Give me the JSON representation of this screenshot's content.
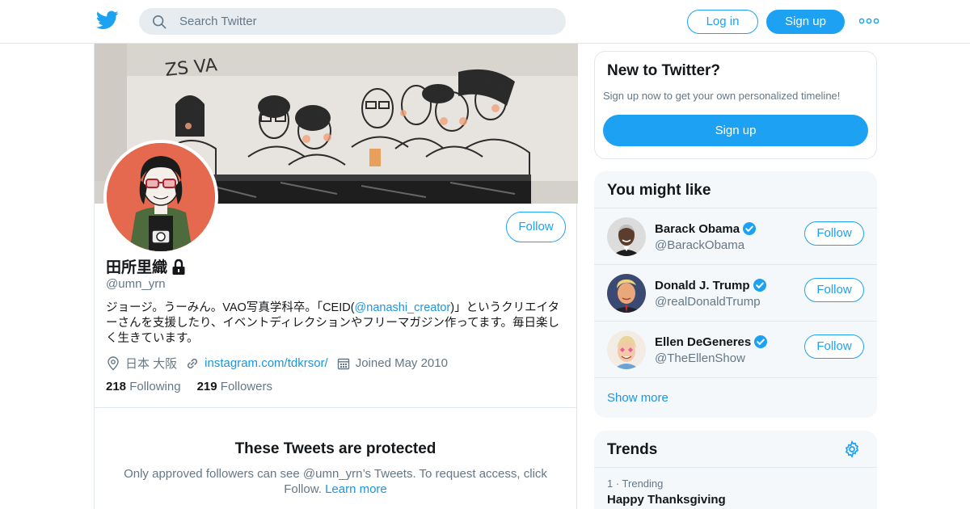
{
  "nav": {
    "search_placeholder": "Search Twitter",
    "login_label": "Log in",
    "signup_label": "Sign up"
  },
  "profile": {
    "display_name": "田所里織",
    "handle": "@umn_yrn",
    "bio_part1": "ジョージ。うーみん。VAO写真学科卒。「CEID(",
    "bio_mention": "@nanashi_creator",
    "bio_part2": ")」というクリエイターさんを支援したり、イベントディレクションやフリーマガジン作ってます。毎日楽しく生きています。",
    "location": "日本 大阪",
    "website": "instagram.com/tdkrsor/",
    "joined": "Joined May 2010",
    "following_count": "218",
    "following_label": "Following",
    "followers_count": "219",
    "followers_label": "Followers",
    "follow_label": "Follow",
    "protected_title": "These Tweets are protected",
    "protected_desc": "Only approved followers can see @umn_yrn’s Tweets. To request access, click Follow.",
    "learn_more": "Learn more"
  },
  "new_to_twitter": {
    "title": "New to Twitter?",
    "subtitle": "Sign up now to get your own personalized timeline!",
    "signup_label": "Sign up"
  },
  "you_might_like": {
    "title": "You might like",
    "users": [
      {
        "name": "Barack Obama",
        "handle": "@BarackObama",
        "follow_label": "Follow"
      },
      {
        "name": "Donald J. Trump",
        "handle": "@realDonaldTrump",
        "follow_label": "Follow"
      },
      {
        "name": "Ellen DeGeneres",
        "handle": "@TheEllenShow",
        "follow_label": "Follow"
      }
    ],
    "show_more": "Show more"
  },
  "trends": {
    "title": "Trends",
    "items": [
      {
        "meta": "1 · Trending",
        "name": "Happy Thanksgiving"
      }
    ]
  },
  "banner_graffiti": "ZS VA",
  "colors": {
    "accent": "#1da1f2",
    "link": "#1b95e0",
    "muted": "#657786",
    "verified": "#1da1f2"
  },
  "icons": [
    "twitter-bird-icon",
    "search-icon",
    "more-dots-icon",
    "lock-icon",
    "location-pin-icon",
    "link-icon",
    "calendar-icon",
    "verified-badge-icon",
    "gear-icon"
  ]
}
